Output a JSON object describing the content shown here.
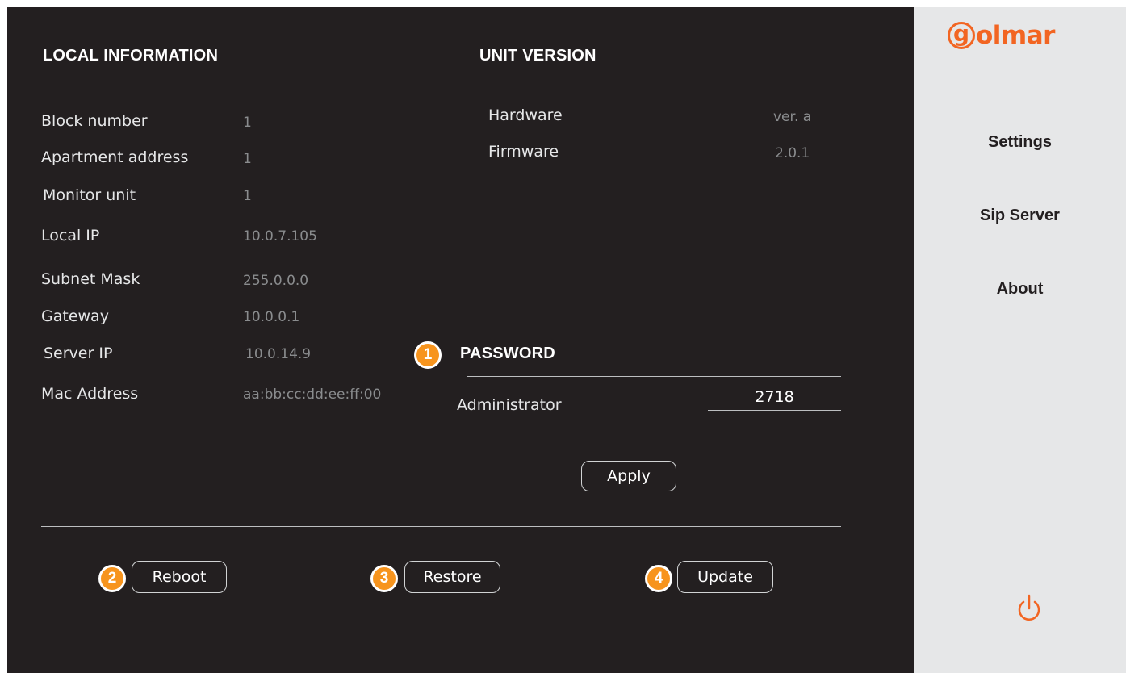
{
  "local_information": {
    "title": "LOCAL INFORMATION",
    "rows": [
      {
        "label": "Block number",
        "value": "1"
      },
      {
        "label": "Apartment address",
        "value": "1"
      },
      {
        "label": "Monitor unit",
        "value": "1"
      },
      {
        "label": "Local IP",
        "value": "10.0.7.105"
      },
      {
        "label": "Subnet Mask",
        "value": "255.0.0.0"
      },
      {
        "label": "Gateway",
        "value": "10.0.0.1"
      },
      {
        "label": "Server IP",
        "value": "10.0.14.9"
      },
      {
        "label": "Mac Address",
        "value": "aa:bb:cc:dd:ee:ff:00"
      }
    ]
  },
  "unit_version": {
    "title": "UNIT VERSION",
    "rows": [
      {
        "label": "Hardware",
        "value": "ver. a"
      },
      {
        "label": "Firmware",
        "value": "2.0.1"
      }
    ]
  },
  "password": {
    "title": "PASSWORD",
    "administrator_label": "Administrator",
    "administrator_value": "2718",
    "apply_label": "Apply"
  },
  "actions": {
    "reboot_label": "Reboot",
    "restore_label": "Restore",
    "update_label": "Update"
  },
  "badges": [
    "1",
    "2",
    "3",
    "4"
  ],
  "sidebar": {
    "logo_letter": "g",
    "logo_text": "olmar",
    "items": [
      {
        "label": "Settings"
      },
      {
        "label": "Sip Server"
      },
      {
        "label": "About"
      }
    ],
    "power_icon": "power-icon"
  },
  "colors": {
    "panel_background": "#231f20",
    "sidebar_background": "#e6e7e8",
    "accent_orange": "#f26522",
    "badge_orange": "#f7941d"
  }
}
